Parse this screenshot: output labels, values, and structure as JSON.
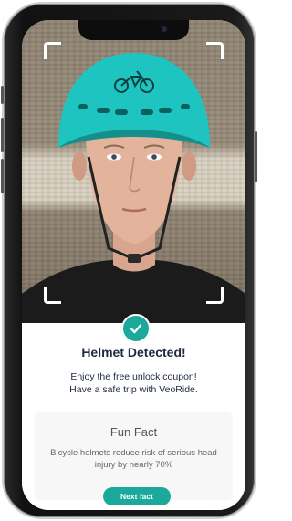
{
  "photo": {
    "description_icon": "person-wearing-teal-bike-helmet",
    "helmet_color": "#1ec4c0"
  },
  "status": {
    "icon": "check-icon",
    "title": "Helmet Detected!",
    "message_line1": "Enjoy the free unlock coupon!",
    "message_line2": "Have a safe trip with VeoRide."
  },
  "fun_fact": {
    "title": "Fun Fact",
    "body": "Bicycle helmets reduce risk of serious head injury by nearly 70%",
    "button_label": "Next fact"
  },
  "colors": {
    "accent": "#1aa99a",
    "text_dark": "#1e2a3f"
  }
}
